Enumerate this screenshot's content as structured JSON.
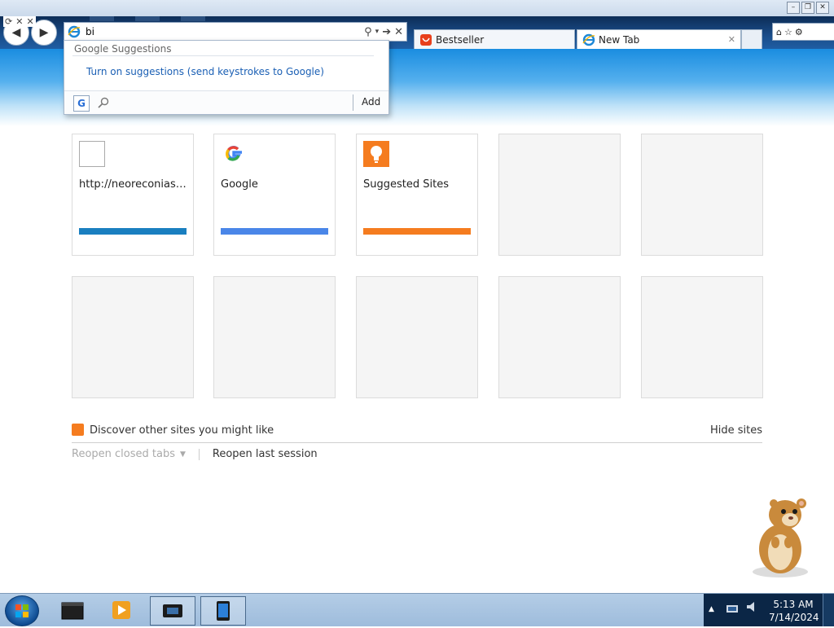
{
  "window": {
    "controls": [
      "minimize",
      "restore",
      "close"
    ]
  },
  "address_bar": {
    "value": "bi",
    "icon": "ie-logo-icon"
  },
  "tabs": [
    {
      "label": "Bestseller",
      "icon": "bestseller-favicon",
      "active": false
    },
    {
      "label": "New Tab",
      "icon": "ie-logo-icon",
      "active": true
    }
  ],
  "suggestions": {
    "header": "Google Suggestions",
    "link": "Turn on suggestions (send keystrokes to Google)",
    "provider_letter": "G",
    "add_label": "Add"
  },
  "tiles_row1": [
    {
      "title": "http://neoreconiasys....",
      "bar_color": "#1a7fc0",
      "icon": "blank-page-icon"
    },
    {
      "title": "Google",
      "bar_color": "#4a86e8",
      "icon": "google-g-icon"
    },
    {
      "title": "Suggested Sites",
      "bar_color": "#f57c1f",
      "icon": "lightbulb-icon"
    },
    {
      "title": "",
      "bar_color": "",
      "icon": ""
    },
    {
      "title": "",
      "bar_color": "",
      "icon": ""
    }
  ],
  "footer": {
    "discover": "Discover other sites you might like",
    "hide": "Hide sites",
    "reopen_closed": "Reopen closed tabs",
    "reopen_last": "Reopen last session"
  },
  "taskbar": {
    "time": "5:13 AM",
    "date": "7/14/2024"
  },
  "colors": {
    "accent": "#1a8de0",
    "link": "#1a5fb4",
    "orange": "#f57c1f"
  }
}
